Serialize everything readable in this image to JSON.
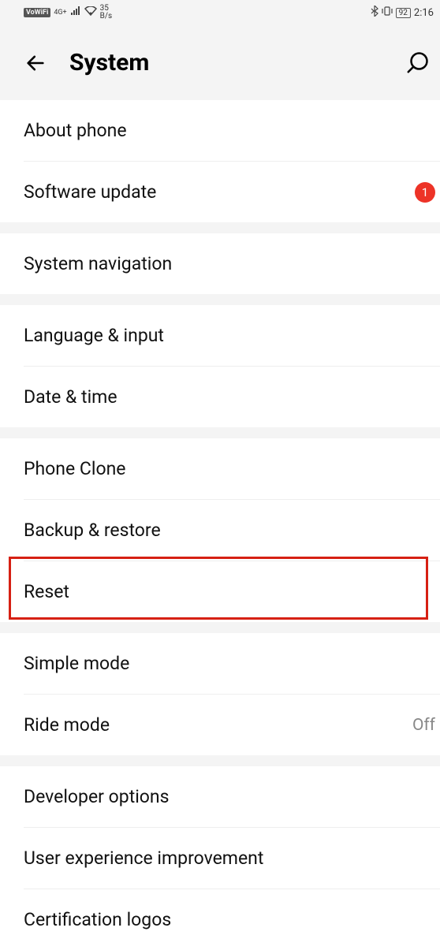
{
  "statusBar": {
    "vowifi": "VoWiFi",
    "network": "4G+",
    "speed": "35",
    "speedUnit": "B/s",
    "battery": "92",
    "time": "2:16"
  },
  "header": {
    "title": "System"
  },
  "groups": [
    {
      "items": [
        {
          "label": "About phone",
          "name": "about-phone"
        },
        {
          "label": "Software update",
          "name": "software-update",
          "badge": "1"
        }
      ]
    },
    {
      "items": [
        {
          "label": "System navigation",
          "name": "system-navigation"
        }
      ]
    },
    {
      "items": [
        {
          "label": "Language & input",
          "name": "language-input"
        },
        {
          "label": "Date & time",
          "name": "date-time"
        }
      ]
    },
    {
      "items": [
        {
          "label": "Phone Clone",
          "name": "phone-clone"
        },
        {
          "label": "Backup & restore",
          "name": "backup-restore"
        },
        {
          "label": "Reset",
          "name": "reset"
        }
      ]
    },
    {
      "items": [
        {
          "label": "Simple mode",
          "name": "simple-mode"
        },
        {
          "label": "Ride mode",
          "name": "ride-mode",
          "value": "Off"
        }
      ]
    },
    {
      "items": [
        {
          "label": "Developer options",
          "name": "developer-options"
        },
        {
          "label": "User experience improvement",
          "name": "user-experience"
        },
        {
          "label": "Certification logos",
          "name": "certification-logos"
        }
      ]
    }
  ]
}
